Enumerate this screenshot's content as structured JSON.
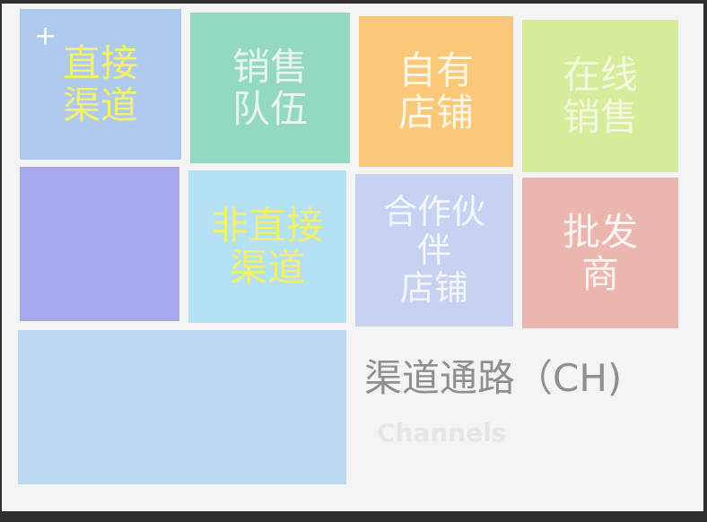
{
  "tiles": {
    "direct_channel": "直接\n渠道",
    "sales_team": "销售\n队伍",
    "own_store": "自有\n店铺",
    "online_sales": "在线\n销售",
    "indirect_channel": "非直接\n渠道",
    "partner_store": "合作伙\n伴\n店铺",
    "wholesaler": "批发\n商"
  },
  "plus_glyph": "+",
  "title": "渠道通路（CH)",
  "subtitle": "Channels",
  "colors": {
    "direct": "#aecbee",
    "sales_team": "#93d9c1",
    "own_store": "#fbc879",
    "online_sales": "#d5ec9a",
    "purple": "#a7a9ec",
    "indirect": "#b4e1f3",
    "partner": "#c7d2f2",
    "wholesaler": "#eab6ad",
    "blank": "#bcd9f3",
    "yellow_text": "#f3f06b"
  }
}
